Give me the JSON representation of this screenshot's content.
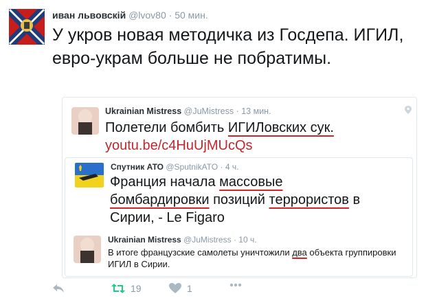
{
  "tweet": {
    "author_name": "иван львовскiй",
    "handle": "@lvov80",
    "separator": "·",
    "time": "50 мин.",
    "text": "У укров новая методичка из Госдепа. ИГИЛ, евро-украм больше не побратимы."
  },
  "quote1": {
    "author_name": "Ukrainian Mistress",
    "handle": "@JuMistress",
    "time": "13 мин.",
    "text_before": "Полетели бомбить ",
    "text_underlined": "ИГИЛовских сук.",
    "link": "youtu.be/c4HuUjMUcQs"
  },
  "quote2": {
    "author_name": "Спутник АТО",
    "handle": "@SputnikATO",
    "time": "4 ч.",
    "t1": "Франция начала ",
    "t1u": "массовые",
    "t2u": "бомбардировки",
    "t2": " позиций ",
    "t2u2": "террористов",
    "t2end": " в",
    "t3": "Сирии, - Le Figaro"
  },
  "quote3": {
    "author_name": "Ukrainian Mistress",
    "handle": "@JuMistress",
    "time": "10 ч.",
    "t1": "В итоге французские самолеты уничтожили ",
    "t1u": "два",
    "t1end": " объекта группировки",
    "t2": "ИГИЛ в Сирии."
  },
  "actions": {
    "retweet_count": "19",
    "like_count": "1"
  },
  "colors": {
    "accent_red": "#c1272d",
    "underline_red": "#d2232a",
    "retweet_green": "#19cf86",
    "muted": "#8899a6"
  },
  "icons": [
    "reply-icon",
    "retweet-icon",
    "heart-icon",
    "more-icon",
    "location-pin-icon"
  ]
}
